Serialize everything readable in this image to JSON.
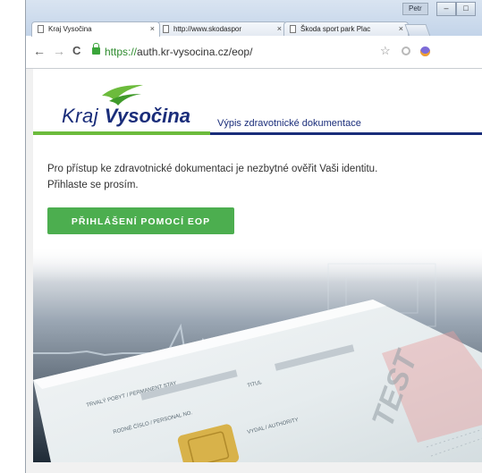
{
  "browser": {
    "user_name": "Petr",
    "window_buttons": [
      "–",
      "□"
    ],
    "tabs": [
      {
        "title": "Kraj Vysočina",
        "close": "×",
        "active": true
      },
      {
        "title": "http://www.skodaspor",
        "close": "×",
        "active": false
      },
      {
        "title": "Škoda sport park Plac",
        "close": "×",
        "active": false
      }
    ],
    "nav": {
      "back": "←",
      "forward": "→",
      "reload": "C"
    },
    "url_scheme": "https://",
    "url_rest": "auth.kr-vysocina.cz/eop/",
    "star": "☆"
  },
  "header": {
    "logo_light": "Kraj ",
    "logo_bold": "Vysočina",
    "title": "Výpis zdravotnické dokumentace"
  },
  "main": {
    "intro_line1": "Pro přístup ke zdravotnické dokumentaci je nezbytné ověřit Vaši identitu.",
    "intro_line2": "Přihlaste se prosím.",
    "login_button": "PŘIHLÁŠENÍ POMOCÍ EOP"
  },
  "card": {
    "label1": "TRVALÝ POBYT / PERMANENT STAY",
    "label2": "RODNÉ ČÍSLO / PERSONAL NO.",
    "label3": "TITUL",
    "label4": "VYDAL / AUTHORITY",
    "watermark": "TEST"
  },
  "colors": {
    "brand_blue": "#1a2d7a",
    "brand_green": "#6cbb3c",
    "button_green": "#4cae4f",
    "url_green": "#2e8b2e"
  }
}
